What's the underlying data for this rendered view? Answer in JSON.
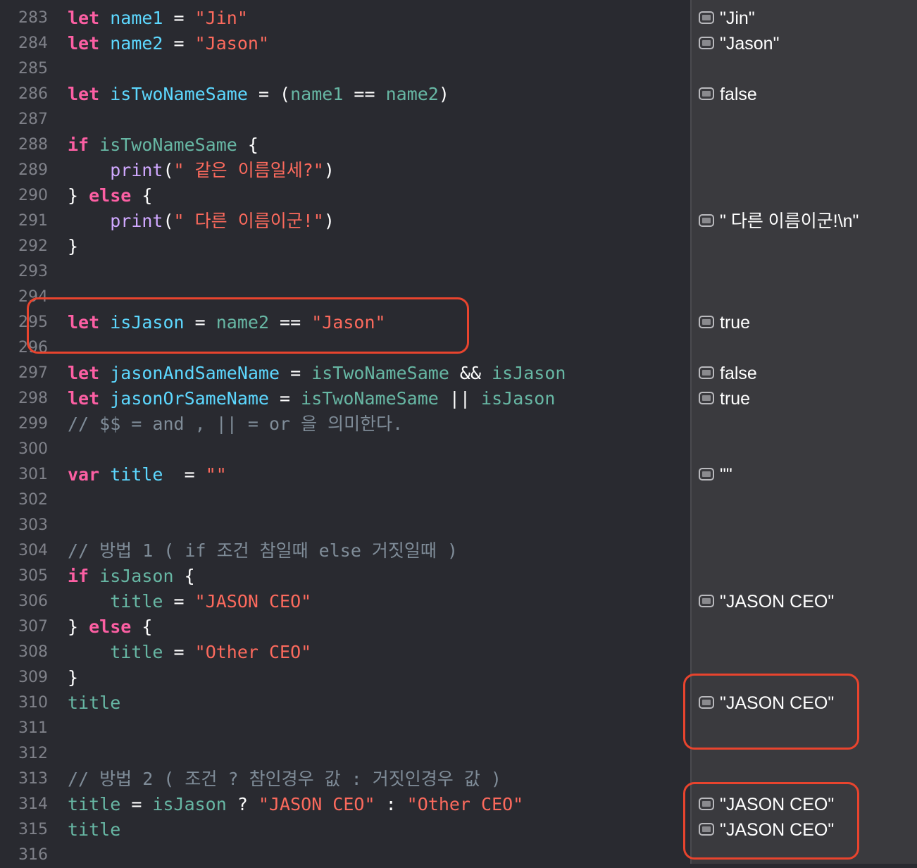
{
  "lines": [
    {
      "no": "283",
      "tokens": [
        [
          "kw",
          "let "
        ],
        [
          "var",
          "name1"
        ],
        [
          "pl",
          " = "
        ],
        [
          "str",
          "\"Jin\""
        ]
      ],
      "result": "\"Jin\""
    },
    {
      "no": "284",
      "tokens": [
        [
          "kw",
          "let "
        ],
        [
          "var",
          "name2"
        ],
        [
          "pl",
          " = "
        ],
        [
          "str",
          "\"Jason\""
        ]
      ],
      "result": "\"Jason\""
    },
    {
      "no": "285",
      "tokens": [],
      "result": ""
    },
    {
      "no": "286",
      "tokens": [
        [
          "kw",
          "let "
        ],
        [
          "var",
          "isTwoNameSame"
        ],
        [
          "pl",
          " = ("
        ],
        [
          "id",
          "name1"
        ],
        [
          "pl",
          " == "
        ],
        [
          "id",
          "name2"
        ],
        [
          "pl",
          ")"
        ]
      ],
      "result": "false"
    },
    {
      "no": "287",
      "tokens": [],
      "result": ""
    },
    {
      "no": "288",
      "tokens": [
        [
          "kw",
          "if "
        ],
        [
          "id",
          "isTwoNameSame"
        ],
        [
          "pl",
          " {"
        ]
      ],
      "result": ""
    },
    {
      "no": "289",
      "tokens": [
        [
          "pl",
          "    "
        ],
        [
          "fn",
          "print"
        ],
        [
          "pl",
          "("
        ],
        [
          "str",
          "\" 같은 이름일세?\""
        ],
        [
          "pl",
          ")"
        ]
      ],
      "result": ""
    },
    {
      "no": "290",
      "tokens": [
        [
          "pl",
          "} "
        ],
        [
          "kw",
          "else"
        ],
        [
          "pl",
          " {"
        ]
      ],
      "result": ""
    },
    {
      "no": "291",
      "tokens": [
        [
          "pl",
          "    "
        ],
        [
          "fn",
          "print"
        ],
        [
          "pl",
          "("
        ],
        [
          "str",
          "\" 다른 이름이군!\""
        ],
        [
          "pl",
          ")"
        ]
      ],
      "result": "\" 다른 이름이군!\\n\""
    },
    {
      "no": "292",
      "tokens": [
        [
          "pl",
          "}"
        ]
      ],
      "result": ""
    },
    {
      "no": "293",
      "tokens": [],
      "result": ""
    },
    {
      "no": "294",
      "tokens": [],
      "result": ""
    },
    {
      "no": "295",
      "tokens": [
        [
          "kw",
          "let "
        ],
        [
          "var",
          "isJason"
        ],
        [
          "pl",
          " = "
        ],
        [
          "id",
          "name2"
        ],
        [
          "pl",
          " == "
        ],
        [
          "str",
          "\"Jason\""
        ]
      ],
      "result": "true"
    },
    {
      "no": "296",
      "tokens": [],
      "result": ""
    },
    {
      "no": "297",
      "tokens": [
        [
          "kw",
          "let "
        ],
        [
          "var",
          "jasonAndSameName"
        ],
        [
          "pl",
          " = "
        ],
        [
          "id",
          "isTwoNameSame"
        ],
        [
          "pl",
          " && "
        ],
        [
          "id",
          "isJason"
        ]
      ],
      "result": "false"
    },
    {
      "no": "298",
      "tokens": [
        [
          "kw",
          "let "
        ],
        [
          "var",
          "jasonOrSameName"
        ],
        [
          "pl",
          " = "
        ],
        [
          "id",
          "isTwoNameSame"
        ],
        [
          "pl",
          " || "
        ],
        [
          "id",
          "isJason"
        ]
      ],
      "result": "true"
    },
    {
      "no": "299",
      "tokens": [
        [
          "cm",
          "// $$ = and , || = or 을 의미한다."
        ]
      ],
      "result": ""
    },
    {
      "no": "300",
      "tokens": [],
      "result": ""
    },
    {
      "no": "301",
      "tokens": [
        [
          "kw",
          "var "
        ],
        [
          "var",
          "title"
        ],
        [
          "pl",
          "  = "
        ],
        [
          "str",
          "\"\""
        ]
      ],
      "result": "\"\""
    },
    {
      "no": "302",
      "tokens": [],
      "result": ""
    },
    {
      "no": "303",
      "tokens": [],
      "result": ""
    },
    {
      "no": "304",
      "tokens": [
        [
          "cm",
          "// 방법 1 ( if 조건 참일때 else 거짓일때 )"
        ]
      ],
      "result": ""
    },
    {
      "no": "305",
      "tokens": [
        [
          "kw",
          "if "
        ],
        [
          "id",
          "isJason"
        ],
        [
          "pl",
          " {"
        ]
      ],
      "result": ""
    },
    {
      "no": "306",
      "tokens": [
        [
          "pl",
          "    "
        ],
        [
          "id",
          "title"
        ],
        [
          "pl",
          " = "
        ],
        [
          "str",
          "\"JASON CEO\""
        ]
      ],
      "result": "\"JASON CEO\""
    },
    {
      "no": "307",
      "tokens": [
        [
          "pl",
          "} "
        ],
        [
          "kw",
          "else"
        ],
        [
          "pl",
          " {"
        ]
      ],
      "result": ""
    },
    {
      "no": "308",
      "tokens": [
        [
          "pl",
          "    "
        ],
        [
          "id",
          "title"
        ],
        [
          "pl",
          " = "
        ],
        [
          "str",
          "\"Other CEO\""
        ]
      ],
      "result": ""
    },
    {
      "no": "309",
      "tokens": [
        [
          "pl",
          "}"
        ]
      ],
      "result": ""
    },
    {
      "no": "310",
      "tokens": [
        [
          "id",
          "title"
        ]
      ],
      "result": "\"JASON CEO\""
    },
    {
      "no": "311",
      "tokens": [],
      "result": ""
    },
    {
      "no": "312",
      "tokens": [],
      "result": ""
    },
    {
      "no": "313",
      "tokens": [
        [
          "cm",
          "// 방법 2 ( 조건 ? 참인경우 값 : 거짓인경우 값 )"
        ]
      ],
      "result": ""
    },
    {
      "no": "314",
      "tokens": [
        [
          "id",
          "title"
        ],
        [
          "pl",
          " = "
        ],
        [
          "id",
          "isJason"
        ],
        [
          "pl",
          " ? "
        ],
        [
          "str",
          "\"JASON CEO\""
        ],
        [
          "pl",
          " : "
        ],
        [
          "str",
          "\"Other CEO\""
        ]
      ],
      "result": "\"JASON CEO\""
    },
    {
      "no": "315",
      "tokens": [
        [
          "id",
          "title"
        ]
      ],
      "result": "\"JASON CEO\""
    },
    {
      "no": "316",
      "tokens": [],
      "result": ""
    }
  ]
}
